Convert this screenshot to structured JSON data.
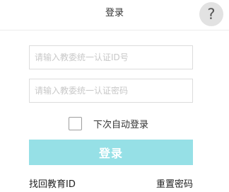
{
  "header": {
    "title": "登录",
    "help_icon": "question-mark-icon",
    "help_glyph": "?"
  },
  "form": {
    "id_placeholder": "请输入教委统一认证ID号",
    "password_placeholder": "请输入教委统一认证密码",
    "remember_label": "下次自动登录",
    "remember_checked": false,
    "login_label": "登录",
    "login_button_color": "#96e0e6"
  },
  "links": {
    "recover_id": "找回教育ID",
    "reset_password": "重置密码"
  }
}
